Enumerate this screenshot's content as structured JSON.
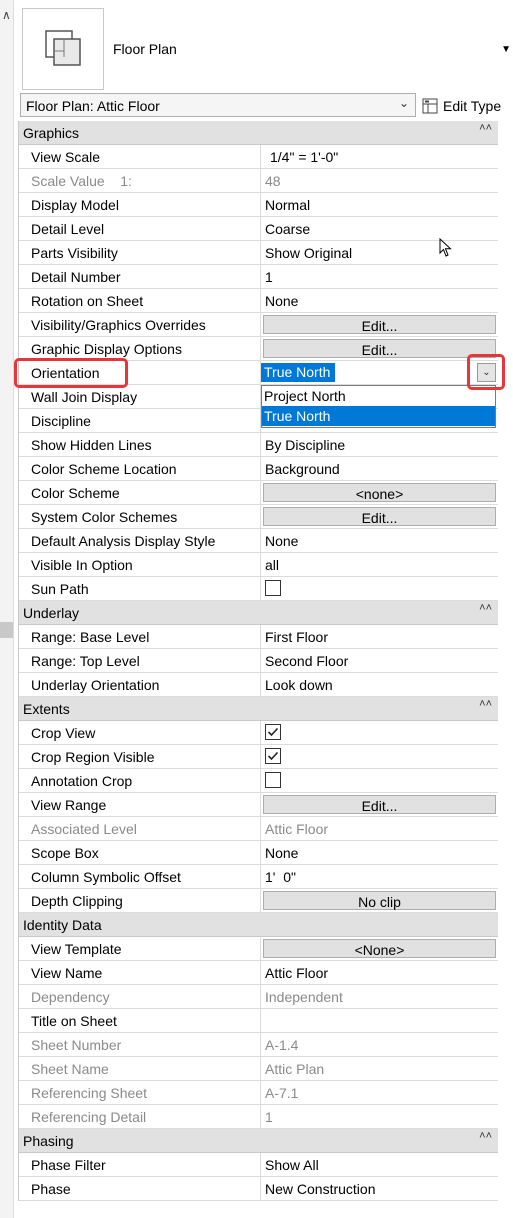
{
  "type_selector": {
    "family": "Floor Plan",
    "selected_type": "Floor Plan: Attic Floor",
    "edit_type_label": "Edit Type"
  },
  "groups": {
    "graphics": {
      "title": "Graphics",
      "rows": [
        {
          "name": "View Scale",
          "value": "1/4\" = 1'-0\""
        },
        {
          "name": "Scale Value    1:",
          "value": "48"
        },
        {
          "name": "Display Model",
          "value": "Normal"
        },
        {
          "name": "Detail Level",
          "value": "Coarse"
        },
        {
          "name": "Parts Visibility",
          "value": "Show Original"
        },
        {
          "name": "Detail Number",
          "value": "1"
        },
        {
          "name": "Rotation on Sheet",
          "value": "None"
        },
        {
          "name": "Visibility/Graphics Overrides",
          "value": "Edit..."
        },
        {
          "name": "Graphic Display Options",
          "value": "Edit..."
        },
        {
          "name": "Orientation",
          "value": "True North"
        },
        {
          "name": "Wall Join Display",
          "value": ""
        },
        {
          "name": "Discipline",
          "value": ""
        },
        {
          "name": "Show Hidden Lines",
          "value": "By Discipline"
        },
        {
          "name": "Color Scheme Location",
          "value": "Background"
        },
        {
          "name": "Color Scheme",
          "value": "<none>"
        },
        {
          "name": "System Color Schemes",
          "value": "Edit..."
        },
        {
          "name": "Default Analysis Display Style",
          "value": "None"
        },
        {
          "name": "Visible In Option",
          "value": "all"
        },
        {
          "name": "Sun Path",
          "value": ""
        }
      ]
    },
    "underlay": {
      "title": "Underlay",
      "rows": [
        {
          "name": "Range: Base Level",
          "value": "First Floor"
        },
        {
          "name": "Range: Top Level",
          "value": "Second Floor"
        },
        {
          "name": "Underlay Orientation",
          "value": "Look down"
        }
      ]
    },
    "extents": {
      "title": "Extents",
      "rows": [
        {
          "name": "Crop View",
          "value": ""
        },
        {
          "name": "Crop Region Visible",
          "value": ""
        },
        {
          "name": "Annotation Crop",
          "value": ""
        },
        {
          "name": "View Range",
          "value": "Edit..."
        },
        {
          "name": "Associated Level",
          "value": "Attic Floor"
        },
        {
          "name": "Scope Box",
          "value": "None"
        },
        {
          "name": "Column Symbolic Offset",
          "value": "1'  0\""
        },
        {
          "name": "Depth Clipping",
          "value": "No clip"
        }
      ]
    },
    "identity": {
      "title": "Identity Data",
      "rows": [
        {
          "name": "View Template",
          "value": "<None>"
        },
        {
          "name": "View Name",
          "value": "Attic Floor"
        },
        {
          "name": "Dependency",
          "value": "Independent"
        },
        {
          "name": "Title on Sheet",
          "value": ""
        },
        {
          "name": "Sheet Number",
          "value": "A-1.4"
        },
        {
          "name": "Sheet Name",
          "value": "Attic Plan"
        },
        {
          "name": "Referencing Sheet",
          "value": "A-7.1"
        },
        {
          "name": "Referencing Detail",
          "value": "1"
        }
      ]
    },
    "phasing": {
      "title": "Phasing",
      "rows": [
        {
          "name": "Phase Filter",
          "value": "Show All"
        },
        {
          "name": "Phase",
          "value": "New Construction"
        }
      ]
    }
  },
  "orientation_dropdown": {
    "options": [
      "Project North",
      "True North"
    ],
    "selected": "True North"
  },
  "checkboxes": {
    "sun_path": false,
    "crop_view": true,
    "crop_region_visible": true,
    "annotation_crop": false
  },
  "icons": {
    "type_thumbnail": "floor-plan-icon",
    "edit_type": "edit-type-icon",
    "collapse": "collapse-chevron-icon",
    "dropdown": "chevron-down-icon"
  },
  "colors": {
    "highlight": "#e5363c",
    "selection": "#0078d7",
    "group_header": "#e1e1e1"
  }
}
